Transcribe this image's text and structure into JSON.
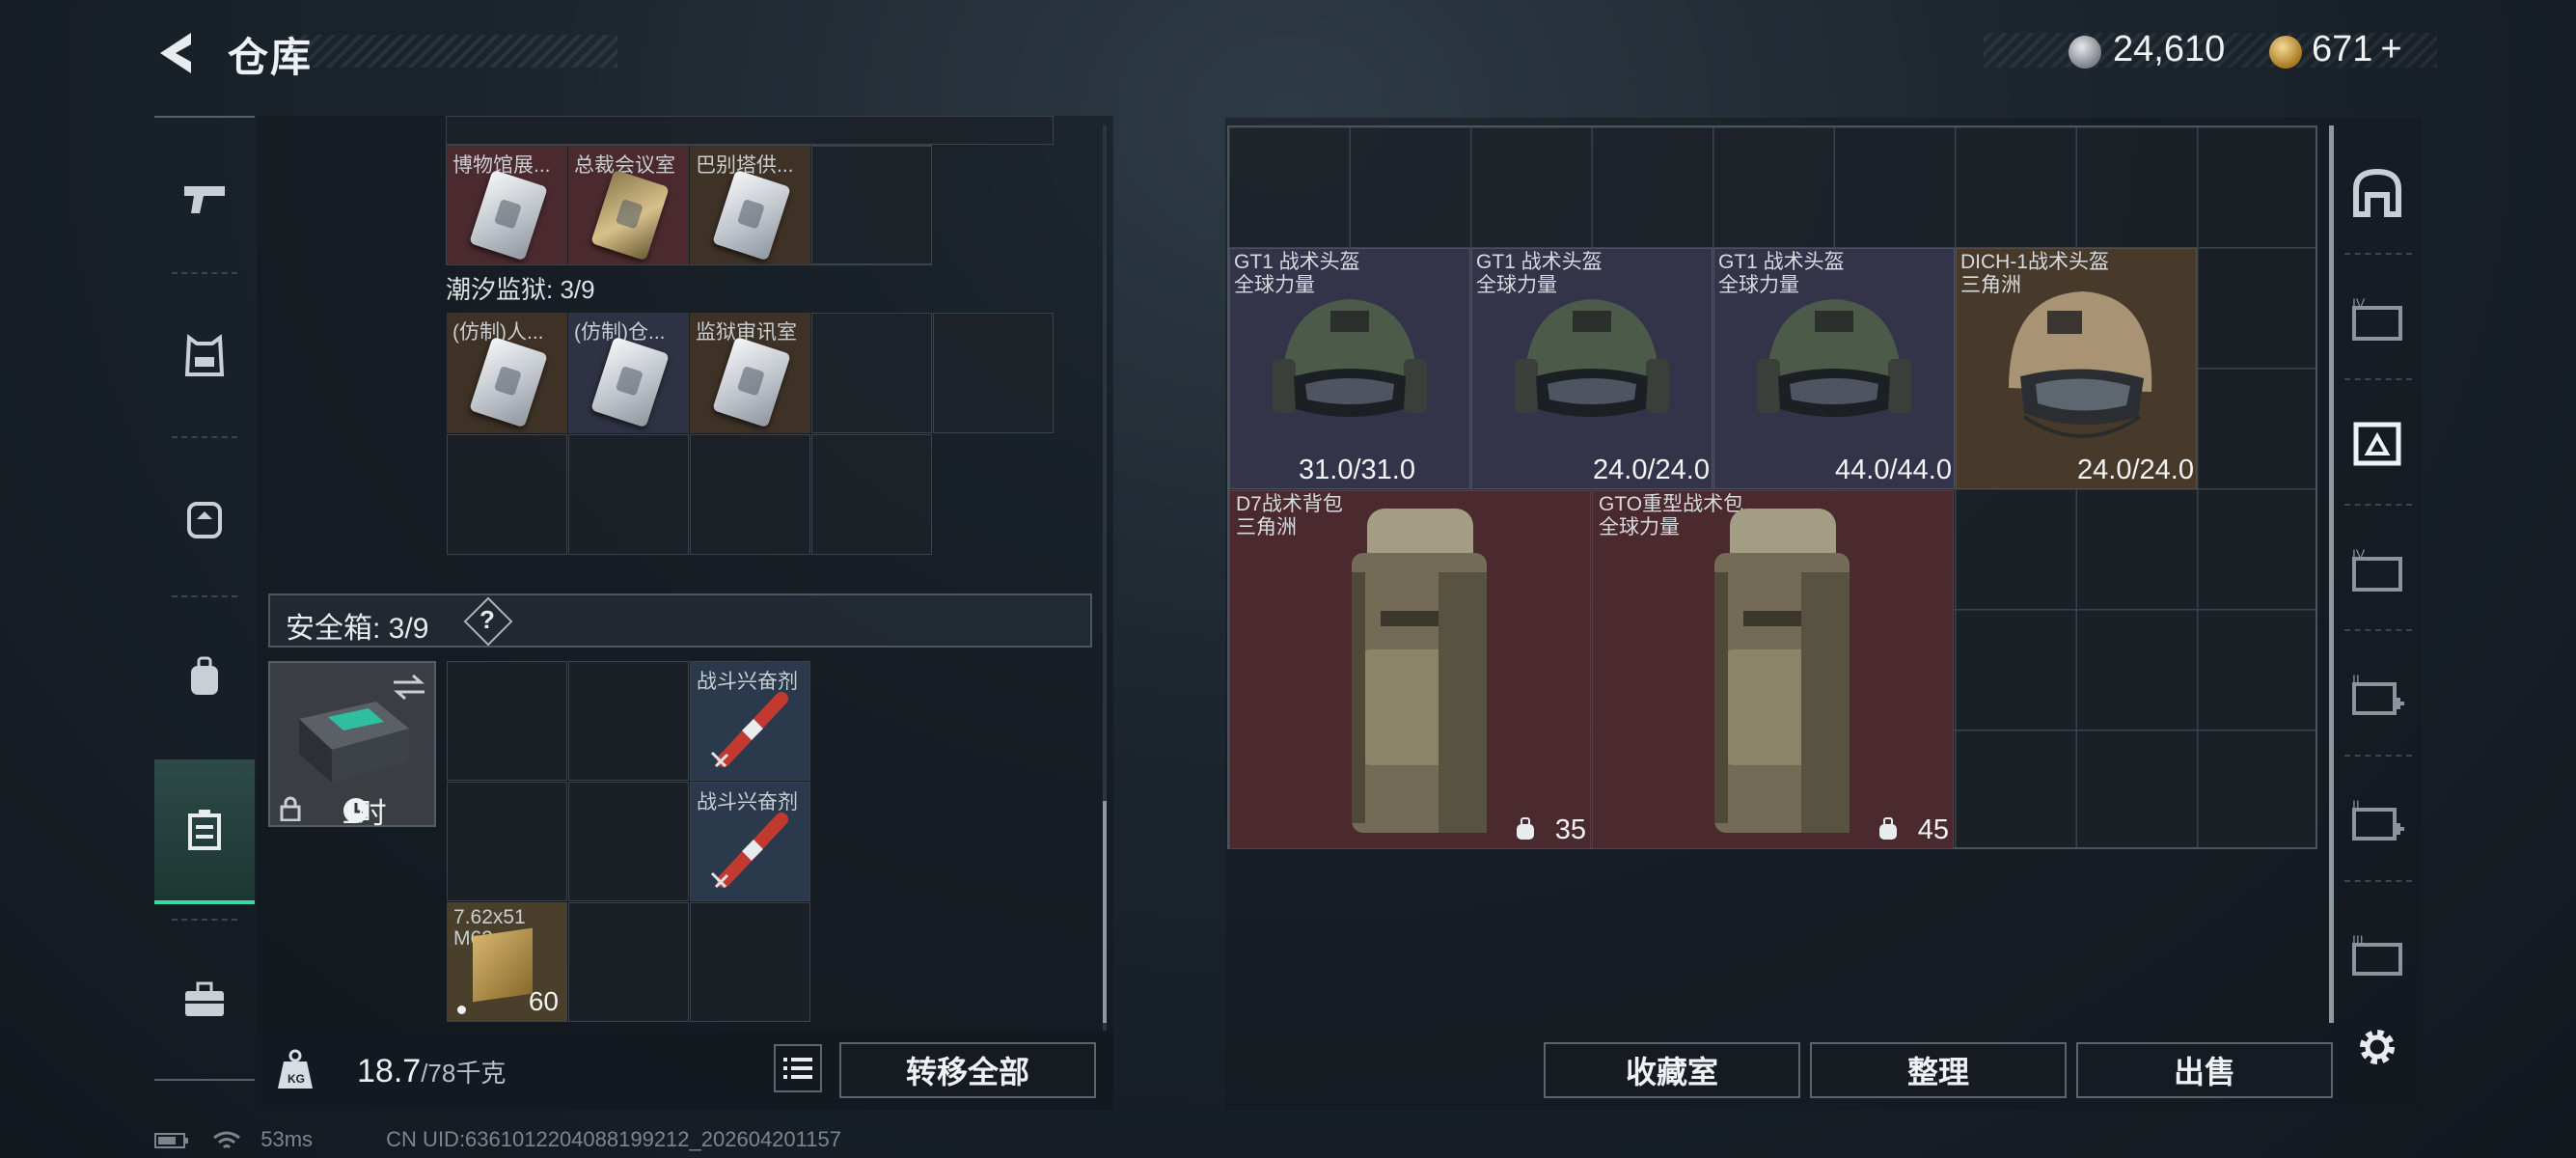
{
  "header": {
    "title": "仓库",
    "currency_silver": "24,610",
    "currency_gold": "671",
    "gold_add": "+"
  },
  "stash": {
    "top_row_items": [
      {
        "name": "博物馆展...",
        "tone": "red"
      },
      {
        "name": "总裁会议室",
        "tone": "gold"
      },
      {
        "name": "巴别塔供...",
        "tone": "brown"
      }
    ],
    "section_label": "潮汐监狱: 3/9",
    "section_items": [
      {
        "name": "(仿制)人...",
        "tone": "brown"
      },
      {
        "name": "(仿制)仓...",
        "tone": "blue"
      },
      {
        "name": "监狱审讯室",
        "tone": "brown"
      }
    ],
    "safe_label": "安全箱: 3/9",
    "safe_help": "?",
    "safe_timer": "1时",
    "safe_items": [
      {
        "name": "战斗兴奋剂"
      },
      {
        "name": "战斗兴奋剂"
      }
    ],
    "ammo_name": "7.62x51 M62",
    "ammo_count": "60",
    "weight_value": "18.7",
    "weight_capacity": "/78千克",
    "transfer_all": "转移全部"
  },
  "storage": {
    "helmets": [
      {
        "name": "GT1 战术头盔",
        "faction": "全球力量",
        "durability": "31.0/31.0"
      },
      {
        "name": "GT1 战术头盔",
        "faction": "全球力量",
        "durability": "24.0/24.0"
      },
      {
        "name": "GT1 战术头盔",
        "faction": "全球力量",
        "durability": "44.0/44.0"
      },
      {
        "name": "DICH-1战术头盔",
        "faction": "三角洲",
        "durability": "24.0/24.0"
      }
    ],
    "backpacks": [
      {
        "name": "D7战术背包",
        "faction": "三角洲",
        "capacity": "35"
      },
      {
        "name": "GTO重型战术包",
        "faction": "全球力量",
        "capacity": "45"
      }
    ],
    "buttons": {
      "collection": "收藏室",
      "organize": "整理",
      "sell": "出售"
    }
  },
  "status_bar": {
    "ping": "53ms",
    "uid": "CN UID:6361012204088199212_202604201157"
  }
}
